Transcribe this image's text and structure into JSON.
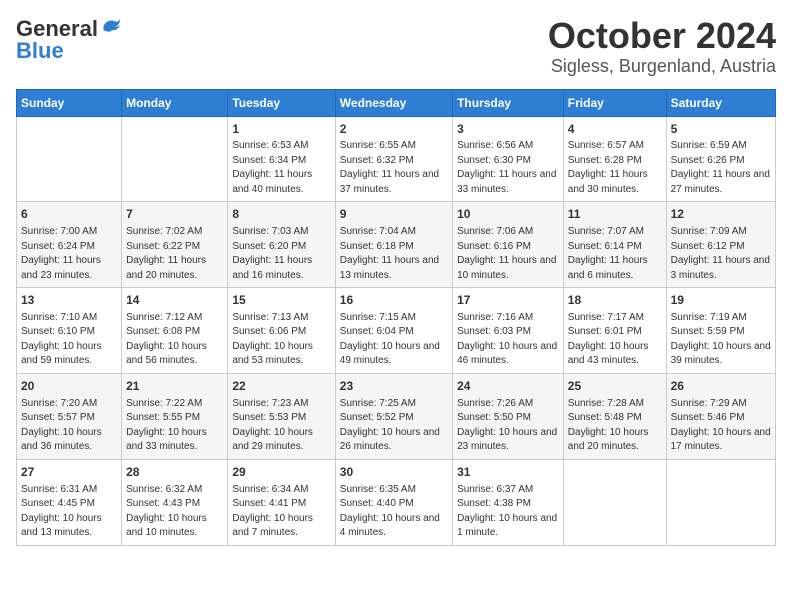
{
  "header": {
    "logo_general": "General",
    "logo_blue": "Blue",
    "month": "October 2024",
    "location": "Sigless, Burgenland, Austria"
  },
  "weekdays": [
    "Sunday",
    "Monday",
    "Tuesday",
    "Wednesday",
    "Thursday",
    "Friday",
    "Saturday"
  ],
  "weeks": [
    [
      {
        "day": "",
        "info": ""
      },
      {
        "day": "",
        "info": ""
      },
      {
        "day": "1",
        "info": "Sunrise: 6:53 AM\nSunset: 6:34 PM\nDaylight: 11 hours and 40 minutes."
      },
      {
        "day": "2",
        "info": "Sunrise: 6:55 AM\nSunset: 6:32 PM\nDaylight: 11 hours and 37 minutes."
      },
      {
        "day": "3",
        "info": "Sunrise: 6:56 AM\nSunset: 6:30 PM\nDaylight: 11 hours and 33 minutes."
      },
      {
        "day": "4",
        "info": "Sunrise: 6:57 AM\nSunset: 6:28 PM\nDaylight: 11 hours and 30 minutes."
      },
      {
        "day": "5",
        "info": "Sunrise: 6:59 AM\nSunset: 6:26 PM\nDaylight: 11 hours and 27 minutes."
      }
    ],
    [
      {
        "day": "6",
        "info": "Sunrise: 7:00 AM\nSunset: 6:24 PM\nDaylight: 11 hours and 23 minutes."
      },
      {
        "day": "7",
        "info": "Sunrise: 7:02 AM\nSunset: 6:22 PM\nDaylight: 11 hours and 20 minutes."
      },
      {
        "day": "8",
        "info": "Sunrise: 7:03 AM\nSunset: 6:20 PM\nDaylight: 11 hours and 16 minutes."
      },
      {
        "day": "9",
        "info": "Sunrise: 7:04 AM\nSunset: 6:18 PM\nDaylight: 11 hours and 13 minutes."
      },
      {
        "day": "10",
        "info": "Sunrise: 7:06 AM\nSunset: 6:16 PM\nDaylight: 11 hours and 10 minutes."
      },
      {
        "day": "11",
        "info": "Sunrise: 7:07 AM\nSunset: 6:14 PM\nDaylight: 11 hours and 6 minutes."
      },
      {
        "day": "12",
        "info": "Sunrise: 7:09 AM\nSunset: 6:12 PM\nDaylight: 11 hours and 3 minutes."
      }
    ],
    [
      {
        "day": "13",
        "info": "Sunrise: 7:10 AM\nSunset: 6:10 PM\nDaylight: 10 hours and 59 minutes."
      },
      {
        "day": "14",
        "info": "Sunrise: 7:12 AM\nSunset: 6:08 PM\nDaylight: 10 hours and 56 minutes."
      },
      {
        "day": "15",
        "info": "Sunrise: 7:13 AM\nSunset: 6:06 PM\nDaylight: 10 hours and 53 minutes."
      },
      {
        "day": "16",
        "info": "Sunrise: 7:15 AM\nSunset: 6:04 PM\nDaylight: 10 hours and 49 minutes."
      },
      {
        "day": "17",
        "info": "Sunrise: 7:16 AM\nSunset: 6:03 PM\nDaylight: 10 hours and 46 minutes."
      },
      {
        "day": "18",
        "info": "Sunrise: 7:17 AM\nSunset: 6:01 PM\nDaylight: 10 hours and 43 minutes."
      },
      {
        "day": "19",
        "info": "Sunrise: 7:19 AM\nSunset: 5:59 PM\nDaylight: 10 hours and 39 minutes."
      }
    ],
    [
      {
        "day": "20",
        "info": "Sunrise: 7:20 AM\nSunset: 5:57 PM\nDaylight: 10 hours and 36 minutes."
      },
      {
        "day": "21",
        "info": "Sunrise: 7:22 AM\nSunset: 5:55 PM\nDaylight: 10 hours and 33 minutes."
      },
      {
        "day": "22",
        "info": "Sunrise: 7:23 AM\nSunset: 5:53 PM\nDaylight: 10 hours and 29 minutes."
      },
      {
        "day": "23",
        "info": "Sunrise: 7:25 AM\nSunset: 5:52 PM\nDaylight: 10 hours and 26 minutes."
      },
      {
        "day": "24",
        "info": "Sunrise: 7:26 AM\nSunset: 5:50 PM\nDaylight: 10 hours and 23 minutes."
      },
      {
        "day": "25",
        "info": "Sunrise: 7:28 AM\nSunset: 5:48 PM\nDaylight: 10 hours and 20 minutes."
      },
      {
        "day": "26",
        "info": "Sunrise: 7:29 AM\nSunset: 5:46 PM\nDaylight: 10 hours and 17 minutes."
      }
    ],
    [
      {
        "day": "27",
        "info": "Sunrise: 6:31 AM\nSunset: 4:45 PM\nDaylight: 10 hours and 13 minutes."
      },
      {
        "day": "28",
        "info": "Sunrise: 6:32 AM\nSunset: 4:43 PM\nDaylight: 10 hours and 10 minutes."
      },
      {
        "day": "29",
        "info": "Sunrise: 6:34 AM\nSunset: 4:41 PM\nDaylight: 10 hours and 7 minutes."
      },
      {
        "day": "30",
        "info": "Sunrise: 6:35 AM\nSunset: 4:40 PM\nDaylight: 10 hours and 4 minutes."
      },
      {
        "day": "31",
        "info": "Sunrise: 6:37 AM\nSunset: 4:38 PM\nDaylight: 10 hours and 1 minute."
      },
      {
        "day": "",
        "info": ""
      },
      {
        "day": "",
        "info": ""
      }
    ]
  ]
}
